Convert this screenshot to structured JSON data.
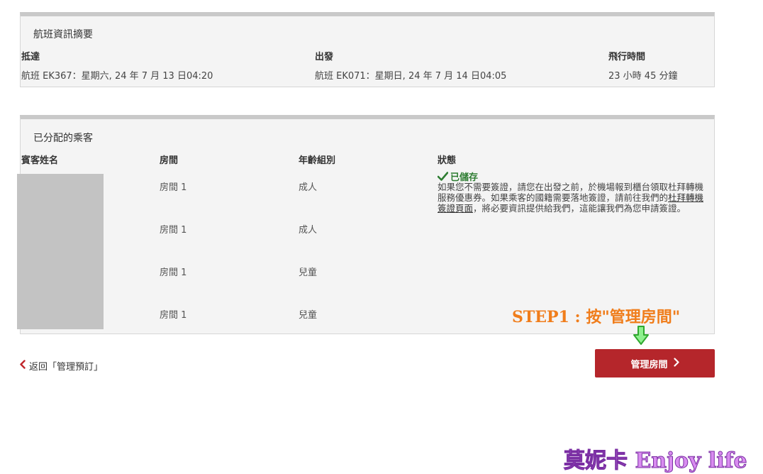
{
  "flight_summary": {
    "title": "航班資訊摘要",
    "columns": [
      {
        "header": "抵達",
        "value": "航班 EK367：星期六, 24 年 7 月 13 日04:20"
      },
      {
        "header": "出發",
        "value": "航班 EK071：星期日, 24 年 7 月 14 日04:05"
      },
      {
        "header": "飛行時間",
        "value": "23 小時 45 分鐘"
      }
    ]
  },
  "passengers": {
    "title": "已分配的乘客",
    "headers": {
      "name": "賓客姓名",
      "room": "房間",
      "age_group": "年齡組別",
      "status": "狀態"
    },
    "rows": [
      {
        "room": "房間 1",
        "age_group": "成人"
      },
      {
        "room": "房間 1",
        "age_group": "成人"
      },
      {
        "room": "房間 1",
        "age_group": "兒童"
      },
      {
        "room": "房間 1",
        "age_group": "兒童"
      }
    ],
    "status": {
      "saved_label": "已儲存",
      "visa_text_1": "如果您不需要簽證，請您在出發之前，於機場報到櫃台領取杜拜轉機服務優惠券。如果乘客的國籍需要落地簽證，請前往我們的",
      "visa_link": "杜拜轉機簽證頁面",
      "visa_text_2": "，將必要資訊提供給我們，這能讓我們為您申請簽證。"
    }
  },
  "nav": {
    "back_label": "返回「管理預訂」",
    "manage_rooms_label": "管理房間"
  },
  "annotation": {
    "step_text": "STEP1 : 按\"管理房間\"",
    "watermark": "莫妮卡 Enjoy life"
  },
  "icons": {
    "check": "check-icon",
    "back": "chevron-left-icon",
    "forward": "chevron-right-icon",
    "arrow": "arrow-down-icon"
  },
  "colors": {
    "accent": "#b5262b",
    "saved": "#2e7d32",
    "annotation": "#f07d1b",
    "watermark": "#d98cf0"
  }
}
